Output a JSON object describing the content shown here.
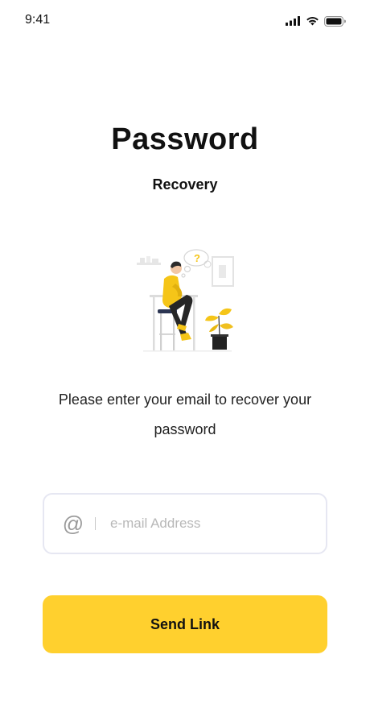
{
  "status_bar": {
    "time": "9:41",
    "icons": [
      "cellular-signal-icon",
      "wifi-icon",
      "battery-icon"
    ]
  },
  "header": {
    "title": "Password",
    "subtitle": "Recovery"
  },
  "illustration": {
    "name": "thinking-person-illustration",
    "question_mark": "?"
  },
  "description": "Please enter your email to recover your password",
  "email": {
    "icon": "at-icon",
    "icon_glyph": "@",
    "placeholder": "e-mail Address",
    "value": ""
  },
  "send_button": {
    "label": "Send Link"
  },
  "colors": {
    "accent": "#FFD02E",
    "input_border": "#E6E7F2",
    "text": "#111111",
    "placeholder": "#B8B8B8"
  }
}
